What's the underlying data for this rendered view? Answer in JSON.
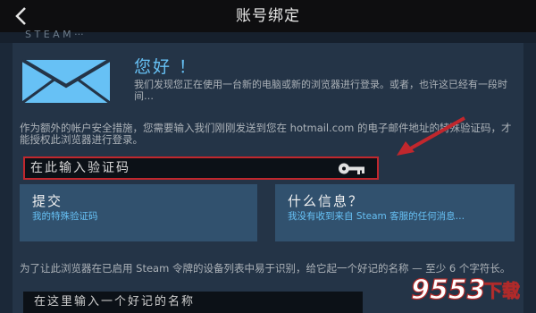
{
  "header": {
    "title": "账号绑定"
  },
  "substrip": {
    "text": "S T E A M  ···"
  },
  "greeting": {
    "title": "您好 ！",
    "intro": "我们发现您正在使用一台新的电脑或新的浏览器进行登录。或者，也许这已经有一段时间…"
  },
  "instruction": "作为额外的帐户安全措施，您需要输入我们刚刚发送到您在 hotmail.com 的电子邮件地址的特殊验证码，才能授权此浏览器进行登录。",
  "code_field": {
    "placeholder": "在此输入验证码"
  },
  "submit": {
    "title": "提交",
    "subtitle": "我的特殊验证码"
  },
  "help": {
    "title": "什么信息？",
    "subtitle": "我没有收到来自 Steam 客服的任何消息…"
  },
  "footer_text": "为了让此浏览器在已启用 Steam 令牌的设备列表中易于识别，给它起一个好记的名称 — 至少 6 个字符长。",
  "name_field": {
    "placeholder": "在这里输入一个好记的名称"
  },
  "watermark": {
    "brand": "9553",
    "suffix": "下载"
  },
  "colors": {
    "accent": "#66c0f4",
    "highlight": "#c1272d",
    "panel": "#243447",
    "button": "#31516e"
  }
}
